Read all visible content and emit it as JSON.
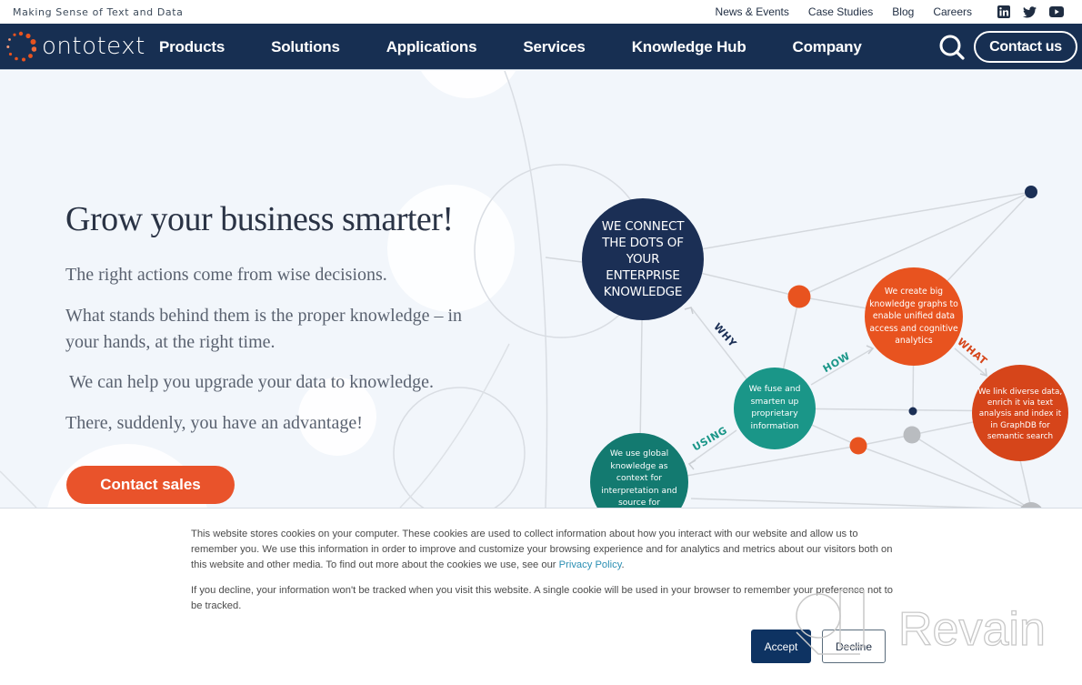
{
  "topbar": {
    "tagline": "Making Sense of Text and Data",
    "links": [
      "News & Events",
      "Case Studies",
      "Blog",
      "Careers"
    ],
    "social": [
      "linkedin-icon",
      "twitter-icon",
      "youtube-icon"
    ]
  },
  "nav": {
    "logo_text": "ontotext",
    "items": [
      "Products",
      "Solutions",
      "Applications",
      "Services",
      "Knowledge Hub",
      "Company"
    ],
    "search_icon": "search-icon",
    "contact_label": "Contact us"
  },
  "hero": {
    "title": "Grow your business smarter!",
    "paragraphs": [
      "The right actions come from wise decisions.",
      "What stands behind them is the proper knowledge – in your hands, at the right time.",
      "We can help you upgrade your data to knowledge.",
      "There, suddenly, you have an advantage!"
    ],
    "cta_label": "Contact sales"
  },
  "diagram": {
    "nodes": {
      "connect": "WE CONNECT THE DOTS OF YOUR ENTERPRISE KNOWLEDGE",
      "create": "We create big knowledge graphs to enable unified data access and cognitive analytics",
      "link": "We link diverse data, enrich it via text analysis and index it in GraphDB for semantic search",
      "fuse": "We fuse and smarten up proprietary information",
      "use": "We use global knowledge as context for interpretation and source for"
    },
    "edges": {
      "why": "WHY",
      "how": "HOW",
      "what": "WHAT",
      "using": "USING"
    },
    "colors": {
      "navy": "#1b2f55",
      "orange": "#e8531f",
      "dark_orange": "#d6451a",
      "teal": "#1a9688",
      "teal_dark": "#137a70",
      "grey": "#b9bcc0"
    }
  },
  "cookie": {
    "text1_before": "This website stores cookies on your computer. These cookies are used to collect information about how you interact with our website and allow us to remember you. We use this information in order to improve and customize your browsing experience and for analytics and metrics about our visitors both on this website and other media. To find out more about the cookies we use, see our ",
    "privacy_link": "Privacy Policy",
    "text1_after": ".",
    "text2": "If you decline, your information won't be tracked when you visit this website. A single cookie will be used in your browser to remember your preference not to be tracked.",
    "accept_label": "Accept",
    "decline_label": "Decline"
  },
  "watermark": {
    "text": "Revain"
  },
  "colors": {
    "nav_bg": "#172f52",
    "cta": "#e9532b",
    "accept": "#0e3362",
    "link": "#2b8fb3"
  }
}
